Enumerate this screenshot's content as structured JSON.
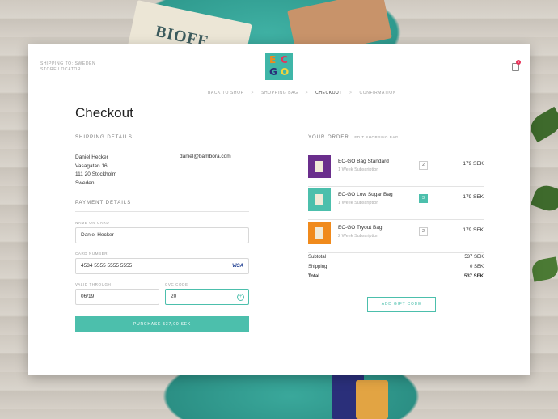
{
  "header": {
    "shipping_to": "SHIPPING TO: SWEDEN",
    "store_locator": "STORE LOCATOR",
    "logo_text": [
      "E",
      "C",
      "G",
      "O"
    ],
    "cart_count": "0"
  },
  "breadcrumbs": [
    "BACK TO SHOP",
    "SHOPPING BAG",
    "CHECKOUT",
    "CONFIRMATION"
  ],
  "breadcrumb_separator": ">",
  "page_title": "Checkout",
  "shipping": {
    "heading": "SHIPPING DETAILS",
    "name": "Daniel Hecker",
    "street": "Vasagatan 16",
    "city": "111 20 Stockholm",
    "country": "Sweden",
    "email": "daniel@bambora.com"
  },
  "payment": {
    "heading": "PAYMENT DETAILS",
    "name_label": "NAME ON CARD",
    "name_value": "Daniel Hecker",
    "card_label": "CARD NUMBER",
    "card_value": "4534 5555 5555 5555",
    "card_brand": "VISA",
    "valid_label": "VALID THROUGH",
    "valid_value": "06/19",
    "cvc_label": "CVC CODE",
    "cvc_value": "20",
    "purchase_button": "PURCHASE 537,00 SEK"
  },
  "order": {
    "heading": "YOUR ORDER",
    "edit_link": "EDIT SHOPPING BAG",
    "items": [
      {
        "name": "EC-GO Bag Standard",
        "sub": "1 Week Subscription",
        "qty": "2",
        "price": "179 SEK",
        "color": "#6a2e8c"
      },
      {
        "name": "EC-GO Low Sugar Bag",
        "sub": "1 Week Subscription",
        "qty": "3",
        "price": "179 SEK",
        "color": "#4cbfac"
      },
      {
        "name": "EC-GO Tryout Bag",
        "sub": "2 Week Subscription",
        "qty": "2",
        "price": "179 SEK",
        "color": "#f08a1c"
      }
    ],
    "subtotal_label": "Subtotal",
    "subtotal_value": "537 SEK",
    "shipping_label": "Shipping",
    "shipping_value": "0 SEK",
    "total_label": "Total",
    "total_value": "537 SEK",
    "gift_button": "ADD GIFT CODE"
  },
  "colors": {
    "accent": "#4cbfac",
    "badge": "#e8335a"
  }
}
